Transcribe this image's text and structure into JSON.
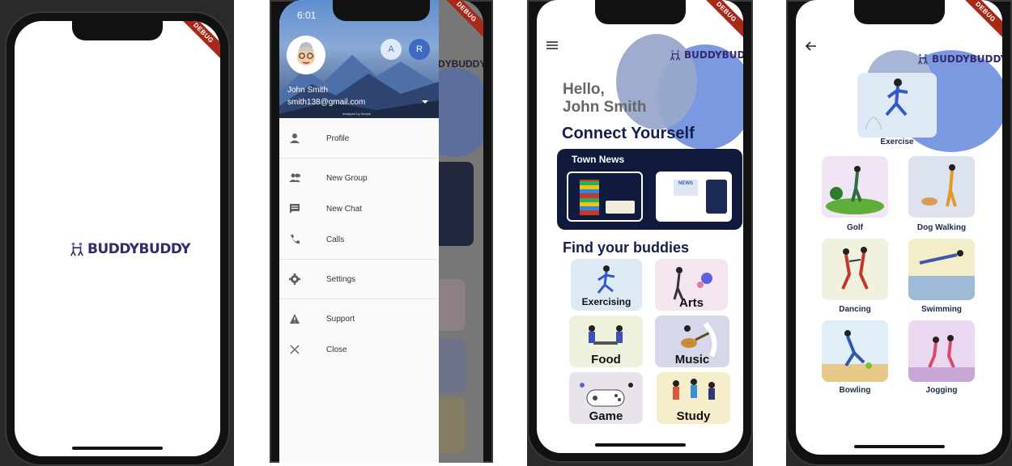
{
  "splash": {
    "logo_text": "BUDDYBUDDY",
    "debug": "DEBUG"
  },
  "drawer": {
    "status_time": "6:01",
    "user_name": "John Smith",
    "user_email": "smith138@gmail.com",
    "accounts": [
      "A",
      "R"
    ],
    "credit": "designed by freepik",
    "items": [
      {
        "label": "Profile",
        "icon": "person-icon"
      },
      {
        "label": "New Group",
        "icon": "group-add-icon"
      },
      {
        "label": "New Chat",
        "icon": "chat-icon"
      },
      {
        "label": "Calls",
        "icon": "phone-icon"
      },
      {
        "label": "Settings",
        "icon": "gear-icon"
      },
      {
        "label": "Support",
        "icon": "warning-icon"
      },
      {
        "label": "Close",
        "icon": "close-icon"
      }
    ]
  },
  "home": {
    "logo_text": "BUDDYBUDDY",
    "greeting_1": "Hello,",
    "greeting_2": "John Smith",
    "connect_title": "Connect Yourself",
    "town_news": "Town News",
    "news_badge": "NEWS",
    "find_title": "Find your buddies",
    "categories": [
      "Exercising",
      "Arts",
      "Food",
      "Music",
      "Game",
      "Study"
    ]
  },
  "exercise": {
    "logo_text": "BUDDYBUDDY",
    "hero_label": "Exercise",
    "activities": [
      "Golf",
      "Dog Walking",
      "Dancing",
      "Swimming",
      "Bowling",
      "Jogging"
    ]
  }
}
